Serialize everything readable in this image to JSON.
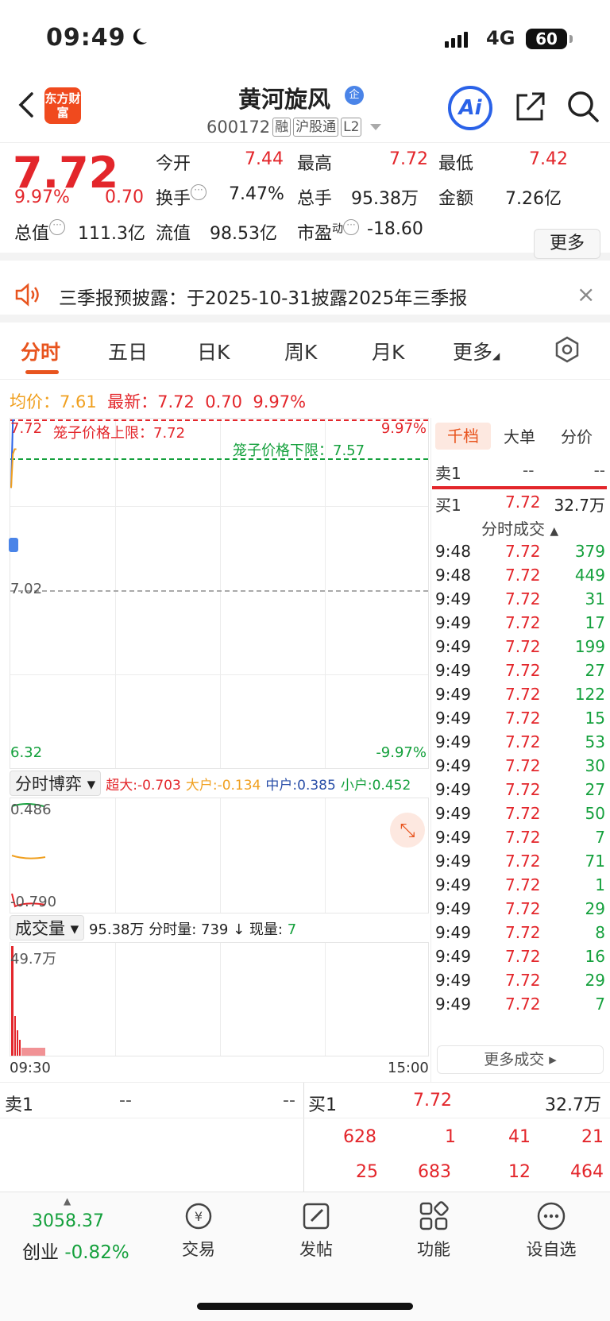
{
  "status_bar": {
    "time": "09:49",
    "network": "4G",
    "battery": "60"
  },
  "header": {
    "logo_text": "东方财富",
    "stock_name": "黄河旋风",
    "ent_badge": "企",
    "stock_code": "600172",
    "tags": [
      "融",
      "沪股通",
      "L2"
    ],
    "ai_label": "Ai"
  },
  "quote": {
    "price": "7.72",
    "change_pct": "9.97%",
    "change": "0.70",
    "open_label": "今开",
    "open": "7.44",
    "high_label": "最高",
    "high": "7.72",
    "low_label": "最低",
    "low": "7.42",
    "turnover_label": "换手",
    "turnover": "7.47%",
    "volume_label": "总手",
    "volume": "95.38万",
    "amount_label": "金额",
    "amount": "7.26亿",
    "mktcap_label": "总值",
    "mktcap": "111.3亿",
    "float_label": "流值",
    "float_cap": "98.53亿",
    "pe_label": "市盈",
    "pe_sup": "动",
    "pe": "-18.60",
    "more_label": "更多"
  },
  "notice": {
    "text": "三季报预披露：于2025-10-31披露2025年三季报"
  },
  "tabs": [
    {
      "label": "分时"
    },
    {
      "label": "五日"
    },
    {
      "label": "日K"
    },
    {
      "label": "周K"
    },
    {
      "label": "月K"
    },
    {
      "label": "更多"
    }
  ],
  "chart_header": {
    "avg_label": "均价：7.61",
    "latest_label": "最新：7.72",
    "change": "0.70",
    "pct": "9.97%"
  },
  "intraday_chart": {
    "y_max": "7.72",
    "y_mid": "7.02",
    "y_min": "6.32",
    "pct_max": "9.97%",
    "pct_min": "-9.97%",
    "upper_limit_label": "笼子价格上限：7.72",
    "lower_limit_label": "笼子价格下限：7.57",
    "x_start": "09:30",
    "x_end": "15:00"
  },
  "chart_data": {
    "type": "line",
    "x": [
      "09:30",
      "09:31",
      "09:32",
      "09:33",
      "09:40",
      "09:48"
    ],
    "series": [
      {
        "values": [
          7.44,
          7.72,
          7.72,
          7.72,
          7.72,
          7.72
        ]
      },
      {
        "values": [
          7.44,
          7.58,
          7.6,
          7.6,
          7.61,
          7.61
        ]
      }
    ],
    "ylim": [
      6.32,
      7.72
    ]
  },
  "game_panel": {
    "dropdown": "分时博弈",
    "super_label": "超大:-0.703",
    "big_label": "大户:-0.134",
    "mid_label": "中户:0.385",
    "small_label": "小户:0.452",
    "y_top": "0.486",
    "y_bottom": "-0.790"
  },
  "volume_panel": {
    "dropdown": "成交量",
    "total": "95.38万",
    "minute_vol": "分时量: 739",
    "arrow": "↓",
    "now_label": "现量:",
    "now_val": "7",
    "y_max": "49.7万"
  },
  "order_panel": {
    "tabs": [
      "千档",
      "大单",
      "分价"
    ],
    "sell1": {
      "label": "卖1",
      "price": "--",
      "vol": "--"
    },
    "buy1": {
      "label": "买1",
      "price": "7.72",
      "vol": "32.7万"
    },
    "deals_title": "分时成交",
    "deals": [
      {
        "t": "9:48",
        "p": "7.72",
        "v": "379"
      },
      {
        "t": "9:48",
        "p": "7.72",
        "v": "449"
      },
      {
        "t": "9:49",
        "p": "7.72",
        "v": "31"
      },
      {
        "t": "9:49",
        "p": "7.72",
        "v": "17"
      },
      {
        "t": "9:49",
        "p": "7.72",
        "v": "199"
      },
      {
        "t": "9:49",
        "p": "7.72",
        "v": "27"
      },
      {
        "t": "9:49",
        "p": "7.72",
        "v": "122"
      },
      {
        "t": "9:49",
        "p": "7.72",
        "v": "15"
      },
      {
        "t": "9:49",
        "p": "7.72",
        "v": "53"
      },
      {
        "t": "9:49",
        "p": "7.72",
        "v": "30"
      },
      {
        "t": "9:49",
        "p": "7.72",
        "v": "27"
      },
      {
        "t": "9:49",
        "p": "7.72",
        "v": "50"
      },
      {
        "t": "9:49",
        "p": "7.72",
        "v": "7"
      },
      {
        "t": "9:49",
        "p": "7.72",
        "v": "71"
      },
      {
        "t": "9:49",
        "p": "7.72",
        "v": "1"
      },
      {
        "t": "9:49",
        "p": "7.72",
        "v": "29"
      },
      {
        "t": "9:49",
        "p": "7.72",
        "v": "8"
      },
      {
        "t": "9:49",
        "p": "7.72",
        "v": "16"
      },
      {
        "t": "9:49",
        "p": "7.72",
        "v": "29"
      },
      {
        "t": "9:49",
        "p": "7.72",
        "v": "7"
      }
    ],
    "more_label": "更多成交 ▸"
  },
  "order_book": {
    "sell1": {
      "label": "卖1",
      "price": "--",
      "vol": "--"
    },
    "buy1": {
      "label": "买1",
      "price": "7.72",
      "vol": "32.7万"
    },
    "queue_row1": [
      "628",
      "1",
      "41",
      "21"
    ],
    "queue_row2": [
      "25",
      "683",
      "12",
      "464"
    ]
  },
  "bottom_nav": {
    "index_value": "3058.37",
    "index_name": "创业",
    "index_change": "-0.82%",
    "items": [
      "交易",
      "发帖",
      "功能",
      "设自选"
    ]
  }
}
